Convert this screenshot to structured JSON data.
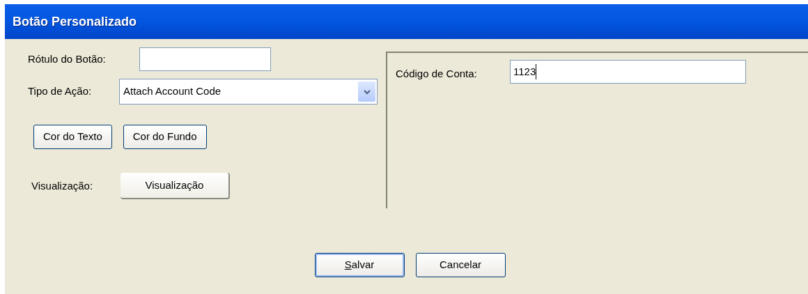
{
  "window": {
    "title": "Botão Personalizado"
  },
  "fields": [
    {
      "label": "Rótulo do Botão:"
    },
    {
      "label": "Tipo de Ação:",
      "value": "Attach Account Code",
      "kind": "dropdown"
    }
  ],
  "color_buttons": [
    "Cor do Texto",
    "Cor do Fundo"
  ],
  "preview": {
    "label": "Visualização:",
    "button": "Visualização"
  },
  "account_panel": {
    "label": "Código de Conta:",
    "value": "1123",
    "focused": true
  },
  "buttons": [
    {
      "label": "Salvar",
      "default": true,
      "underline_first": true
    },
    {
      "label": "Cancelar",
      "default": false,
      "underline_first": false
    }
  ]
}
